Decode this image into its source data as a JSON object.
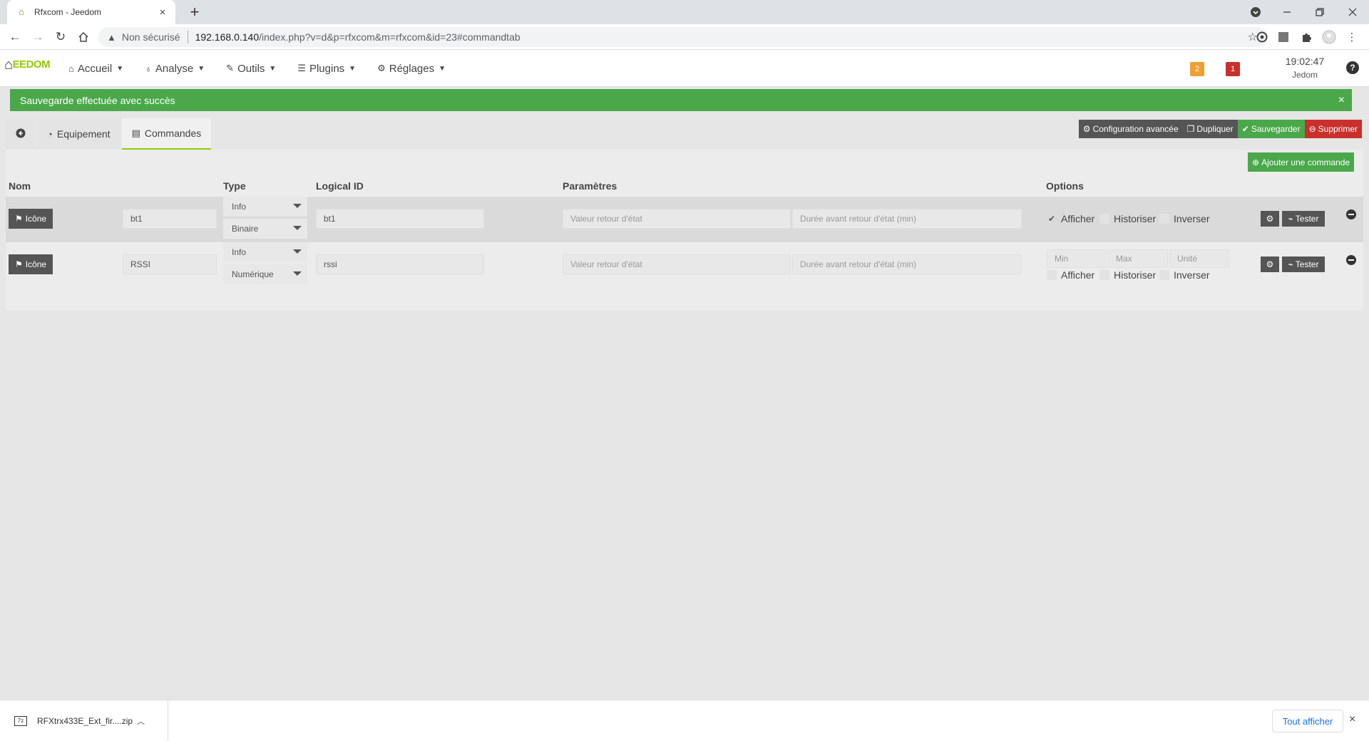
{
  "browser": {
    "tab_title": "Rfxcom - Jeedom",
    "tab_close": "×",
    "new_tab": "+",
    "insecure_label": "Non sécurisé",
    "url_host": "192.168.0.140",
    "url_path": "/index.php?v=d&p=rfxcom&m=rfxcom&id=23#commandtab"
  },
  "navbar": {
    "logo": "EEDOM",
    "menu": [
      {
        "label": "Accueil",
        "icon": "home-icon"
      },
      {
        "label": "Analyse",
        "icon": "stethoscope-icon"
      },
      {
        "label": "Outils",
        "icon": "wrench-icon"
      },
      {
        "label": "Plugins",
        "icon": "list-icon"
      },
      {
        "label": "Réglages",
        "icon": "gear-icon"
      }
    ],
    "badge_warning": "2",
    "badge_danger": "1",
    "time": "19:02:47",
    "user": "Jedom",
    "warning_color": "#f0a030",
    "danger_color": "#c9302c"
  },
  "alert": {
    "message": "Sauvegarde effectuée avec succès",
    "close": "×",
    "color": "#4aa84a"
  },
  "tabs": [
    {
      "label": "Equipement",
      "icon": "dashboard-icon"
    },
    {
      "label": "Commandes",
      "icon": "list-alt-icon",
      "active": true
    }
  ],
  "actions": {
    "advanced": "Configuration avancée",
    "duplicate": "Dupliquer",
    "save": "Sauvegarder",
    "delete": "Supprimer",
    "add_command": "Ajouter une commande"
  },
  "table": {
    "headers": {
      "name": "Nom",
      "type": "Type",
      "logical_id": "Logical ID",
      "params": "Paramètres",
      "options": "Options"
    },
    "rows": [
      {
        "icon_btn": "Icône",
        "name": "bt1",
        "type": "Info",
        "subtype": "Binaire",
        "logical_id": "bt1",
        "param1_placeholder": "Valeur retour d'état",
        "param2_placeholder": "Durée avant retour d'état (min)",
        "show": "Afficher",
        "history": "Historiser",
        "invert": "Inverser",
        "test": "Tester",
        "show_checked": true
      },
      {
        "icon_btn": "Icône",
        "name": "RSSI",
        "type": "Info",
        "subtype": "Numérique",
        "logical_id": "rssi",
        "param1_placeholder": "Valeur retour d'état",
        "param2_placeholder": "Durée avant retour d'état (min)",
        "min_placeholder": "Min",
        "max_placeholder": "Max",
        "unit_placeholder": "Unité",
        "show": "Afficher",
        "history": "Historiser",
        "invert": "Inverser",
        "test": "Tester",
        "show_checked": false
      }
    ]
  },
  "downloads": {
    "file_name": "RFXtrx433E_Ext_fir....zip",
    "show_all": "Tout afficher",
    "close": "×"
  }
}
